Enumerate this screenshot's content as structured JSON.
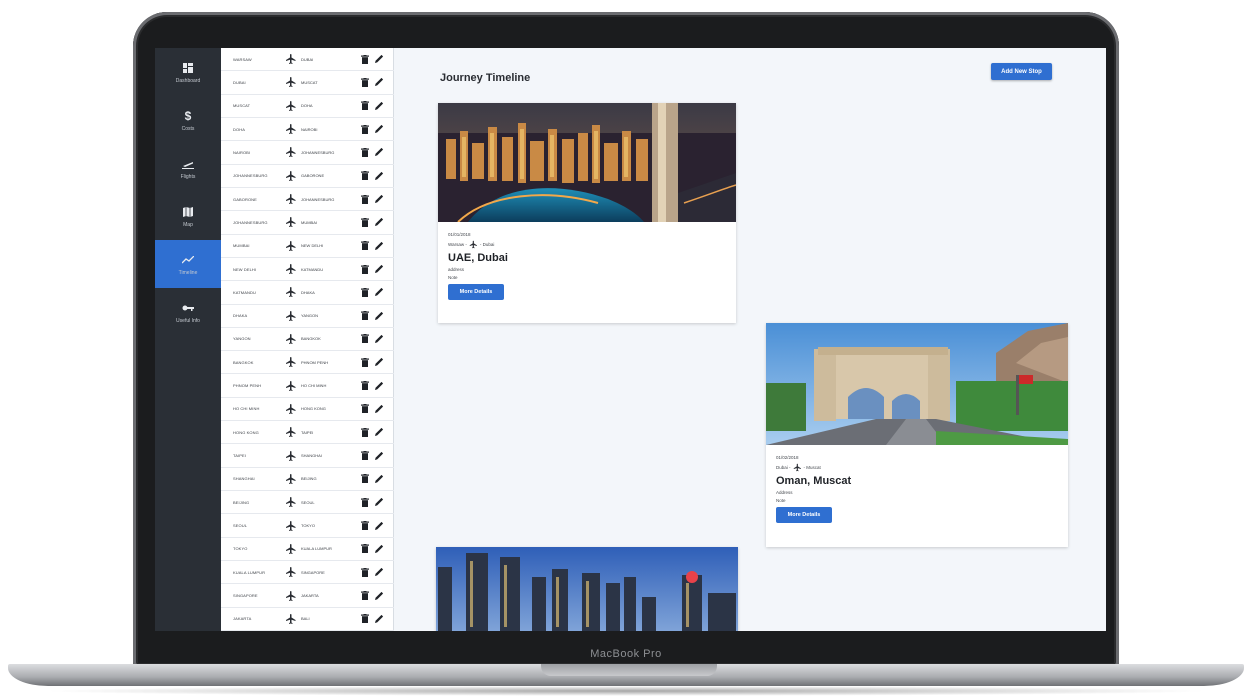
{
  "device": {
    "brand_label": "MacBook Pro"
  },
  "nav": {
    "items": [
      {
        "label": "Dashboard",
        "icon": "dashboard-icon",
        "active": false
      },
      {
        "label": "Costs",
        "icon": "dollar-icon",
        "active": false
      },
      {
        "label": "Flights",
        "icon": "plane-icon",
        "active": false
      },
      {
        "label": "Map",
        "icon": "map-icon",
        "active": false
      },
      {
        "label": "Timeline",
        "icon": "trend-icon",
        "active": true
      },
      {
        "label": "Useful Info",
        "icon": "key-icon",
        "active": false
      }
    ]
  },
  "stops": [
    {
      "from": "WARSAW",
      "to": "DUBAI"
    },
    {
      "from": "DUBAI",
      "to": "MUSCAT"
    },
    {
      "from": "MUSCAT",
      "to": "DOHA"
    },
    {
      "from": "DOHA",
      "to": "NAIROBI"
    },
    {
      "from": "NAIROBI",
      "to": "JOHANNESBURG"
    },
    {
      "from": "JOHANNESBURG",
      "to": "GABORONE"
    },
    {
      "from": "GABORONE",
      "to": "JOHANNESBURG"
    },
    {
      "from": "JOHANNESBURG",
      "to": "MUMBAI"
    },
    {
      "from": "MUMBAI",
      "to": "NEW DELHI"
    },
    {
      "from": "NEW DELHI",
      "to": "KATMANDU"
    },
    {
      "from": "KATMANDU",
      "to": "DHAKA"
    },
    {
      "from": "DHAKA",
      "to": "YANGON"
    },
    {
      "from": "YANGON",
      "to": "BANGKOK"
    },
    {
      "from": "BANGKOK",
      "to": "PHNOM PENH"
    },
    {
      "from": "PHNOM PENH",
      "to": "HO CHI MINH"
    },
    {
      "from": "HO CHI MINH",
      "to": "HONG KONG"
    },
    {
      "from": "HONG KONG",
      "to": "TAIPEI"
    },
    {
      "from": "TAIPEI",
      "to": "SHANGHAI"
    },
    {
      "from": "SHANGHAI",
      "to": "BEIJING"
    },
    {
      "from": "BEIJING",
      "to": "SEOUL"
    },
    {
      "from": "SEOUL",
      "to": "TOKYO"
    },
    {
      "from": "TOKYO",
      "to": "KUALA LUMPUR"
    },
    {
      "from": "KUALA LUMPUR",
      "to": "SINGAPORE"
    },
    {
      "from": "SINGAPORE",
      "to": "JAKARTA"
    },
    {
      "from": "JAKARTA",
      "to": "BALI"
    }
  ],
  "main": {
    "title": "Journey Timeline",
    "add_button": "Add New Stop",
    "cards": [
      {
        "date": "01/01/2018",
        "from": "Warsaw -",
        "to": "- Dubai",
        "title": "UAE, Dubai",
        "address": "address",
        "note": "Note",
        "button": "More Details"
      },
      {
        "date": "01/02/2018",
        "from": "Dubai -",
        "to": "- Muscat",
        "title": "Oman, Muscat",
        "address": "Address",
        "note": "Note",
        "button": "More Details"
      }
    ]
  },
  "colors": {
    "accent": "#2f6fd1",
    "nav_bg": "#2a2f36",
    "page_bg": "#f3f6fa"
  }
}
